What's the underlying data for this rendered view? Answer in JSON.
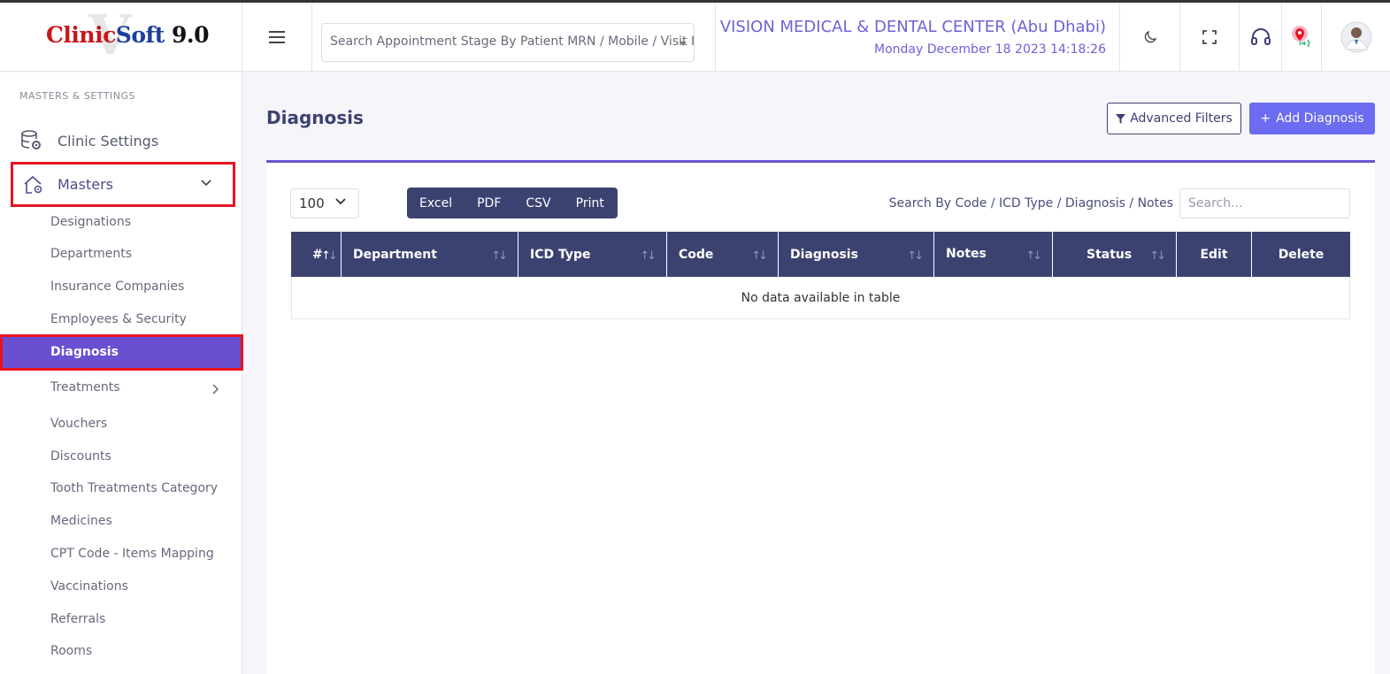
{
  "app": {
    "logo_part1": "Clinic",
    "logo_part2": "Soft",
    "logo_part3": " 9.0"
  },
  "header": {
    "search_placeholder": "Search Appointment Stage By Patient MRN / Mobile / Visit ID",
    "clinic_name": "VISION MEDICAL & DENTAL CENTER (Abu Dhabi)",
    "datetime": "Monday December 18 2023 14:18:26",
    "icons": [
      "menu-icon",
      "moon-icon",
      "fullscreen-icon",
      "headset-icon",
      "location-broadcast-icon",
      "avatar"
    ]
  },
  "sidebar": {
    "section_title": "MASTERS & SETTINGS",
    "clinic_settings": "Clinic Settings",
    "masters": "Masters",
    "items": [
      "Designations",
      "Departments",
      "Insurance Companies",
      "Employees & Security",
      "Diagnosis",
      "Treatments",
      "Vouchers",
      "Discounts",
      "Tooth Treatments Category",
      "Medicines",
      "CPT Code - Items Mapping",
      "Vaccinations",
      "Referrals",
      "Rooms"
    ]
  },
  "page": {
    "title": "Diagnosis",
    "advanced_filters": "Advanced Filters",
    "add_button": "Add Diagnosis",
    "add_plus": "+"
  },
  "table_controls": {
    "page_length": "100",
    "export_buttons": [
      "Excel",
      "PDF",
      "CSV",
      "Print"
    ],
    "search_label": "Search By Code / ICD Type / Diagnosis / Notes",
    "search_placeholder": "Search..."
  },
  "table": {
    "columns": [
      "#",
      "Department",
      "ICD Type",
      "Code",
      "Diagnosis",
      "Notes",
      "Status",
      "Edit",
      "Delete"
    ],
    "empty_message": "No data available in table"
  },
  "colors": {
    "accent": "#6a4fd0",
    "header_dark": "#3c4270",
    "highlight_border": "#e8131f",
    "add_button": "#6b6cef"
  }
}
